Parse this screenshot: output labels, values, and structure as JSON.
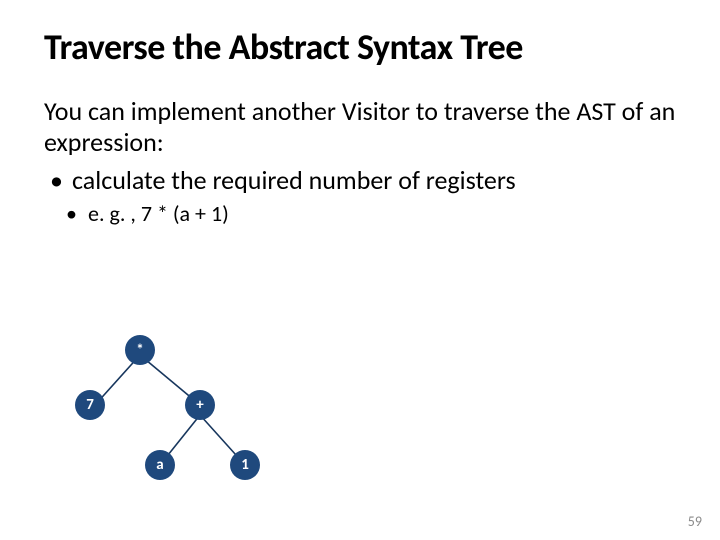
{
  "title": "Traverse the Abstract Syntax Tree",
  "intro": "You can implement another Visitor to traverse the AST of an expression:",
  "bullets": {
    "lvl1": "calculate the required number of registers",
    "lvl2": "e. g. , 7 * (a + 1)"
  },
  "tree": {
    "root": "*",
    "left": "7",
    "right": "+",
    "right_left": "a",
    "right_right": "1"
  },
  "page_number": "59"
}
